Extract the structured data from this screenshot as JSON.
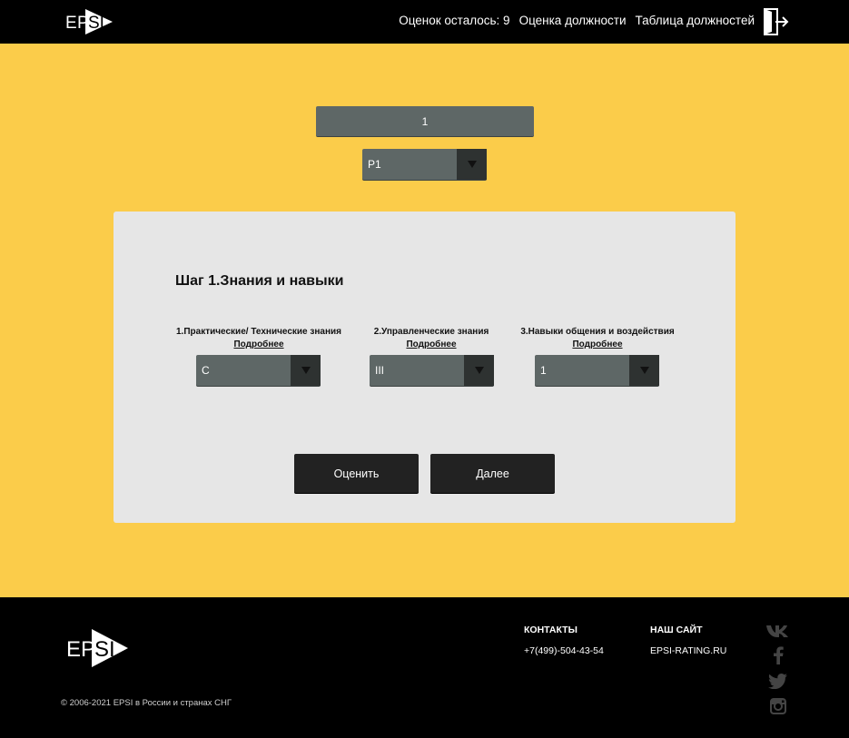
{
  "header": {
    "logo_text": "EPSI",
    "nav": {
      "remaining": "Оценок осталось: 9",
      "evaluation": "Оценка должности",
      "table": "Таблица должностей"
    }
  },
  "top": {
    "number_value": "1",
    "grade_select": "P1"
  },
  "card": {
    "step_title": "Шаг 1.Знания и навыки",
    "criteria": [
      {
        "label": "1.Практические/ Технические знания",
        "more": "Подробнее",
        "value": "C"
      },
      {
        "label": "2.Управленческие знания",
        "more": "Подробнее",
        "value": "III"
      },
      {
        "label": "3.Навыки общения и воздействия",
        "more": "Подробнее",
        "value": "1"
      }
    ],
    "buttons": {
      "rate": "Оценить",
      "next": "Далее"
    }
  },
  "footer": {
    "logo_text": "EPSI",
    "copyright": "© 2006-2021 EPSI в России и странах СНГ",
    "contacts_heading": "КОНТАКТЫ",
    "phone": "+7(499)-504-43-54",
    "site_heading": "НАШ САЙТ",
    "site": "EPSI-RATING.RU",
    "socials": [
      "vk-icon",
      "facebook-icon",
      "twitter-icon",
      "instagram-icon"
    ]
  },
  "colors": {
    "page_bg": "#fbcc4a",
    "header_bg": "#000000",
    "card_bg": "#e6e6e6",
    "select_bg": "#5e6766",
    "button_bg": "#222222"
  }
}
